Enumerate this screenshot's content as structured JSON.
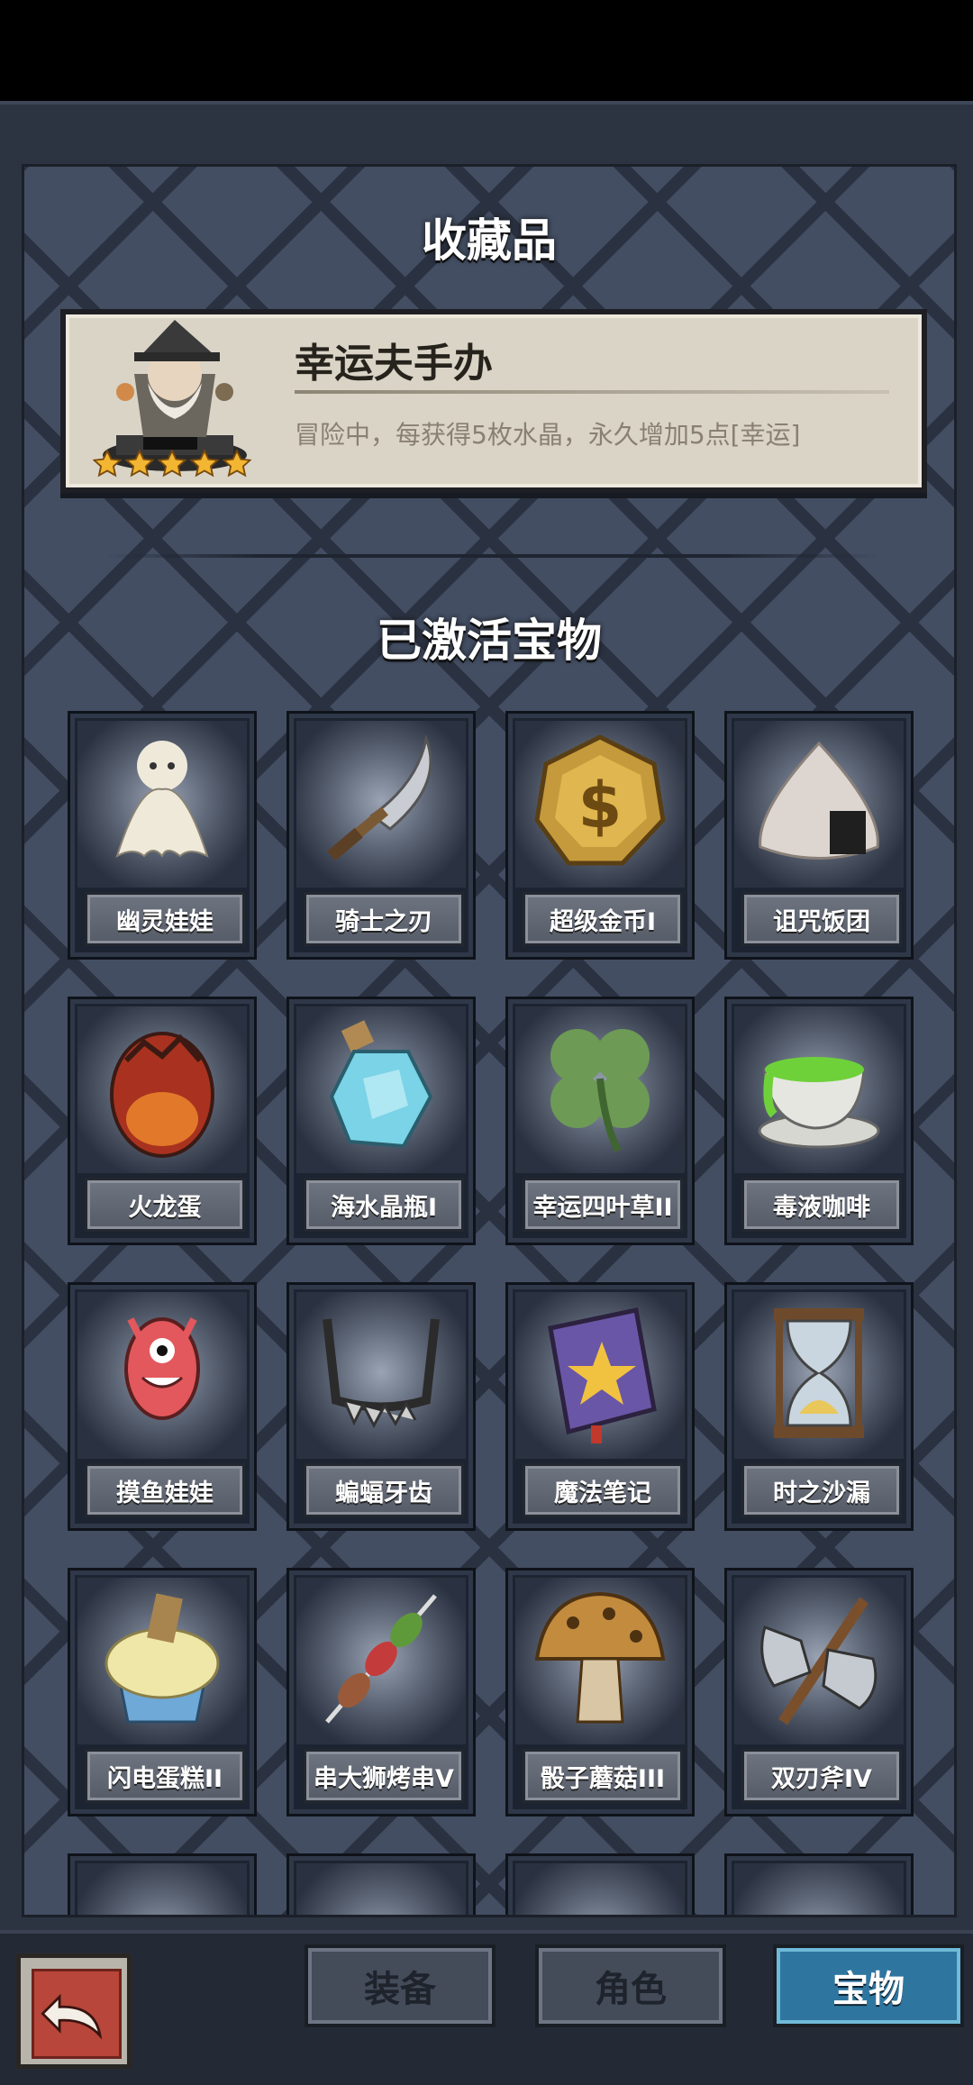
{
  "collection": {
    "title": "收藏品",
    "item_name": "幸运夫手办",
    "item_desc": "冒险中，每获得5枚水晶，永久增加5点[幸运]",
    "stars": 5
  },
  "activated": {
    "title": "已激活宝物",
    "items": [
      {
        "label": "幽灵娃娃",
        "icon": "ghost-doll-icon"
      },
      {
        "label": "骑士之刃",
        "icon": "knight-blade-icon"
      },
      {
        "label": "超级金币I",
        "icon": "gold-coin-icon"
      },
      {
        "label": "诅咒饭团",
        "icon": "rice-ball-icon"
      },
      {
        "label": "火龙蛋",
        "icon": "dragon-egg-icon"
      },
      {
        "label": "海水晶瓶I",
        "icon": "crystal-bottle-icon"
      },
      {
        "label": "幸运四叶草II",
        "icon": "clover-icon"
      },
      {
        "label": "毒液咖啡",
        "icon": "poison-coffee-icon"
      },
      {
        "label": "摸鱼娃娃",
        "icon": "fish-doll-icon"
      },
      {
        "label": "蝙蝠牙齿",
        "icon": "bat-fang-icon"
      },
      {
        "label": "魔法笔记",
        "icon": "magic-book-icon"
      },
      {
        "label": "时之沙漏",
        "icon": "hourglass-icon"
      },
      {
        "label": "闪电蛋糕II",
        "icon": "cupcake-icon"
      },
      {
        "label": "串大狮烤串V",
        "icon": "skewer-icon"
      },
      {
        "label": "骰子蘑菇III",
        "icon": "mushroom-icon"
      },
      {
        "label": "双刃斧IV",
        "icon": "double-axe-icon"
      }
    ]
  },
  "bottom_nav": {
    "back_icon": "back-arrow-icon",
    "tabs": [
      {
        "label": "装备",
        "active": false
      },
      {
        "label": "角色",
        "active": false
      },
      {
        "label": "宝物",
        "active": true
      }
    ]
  },
  "colors": {
    "panel_bg": "#434e63",
    "active_tab": "#2e76a0",
    "back_button": "#b8463a",
    "star": "#f2b632"
  }
}
